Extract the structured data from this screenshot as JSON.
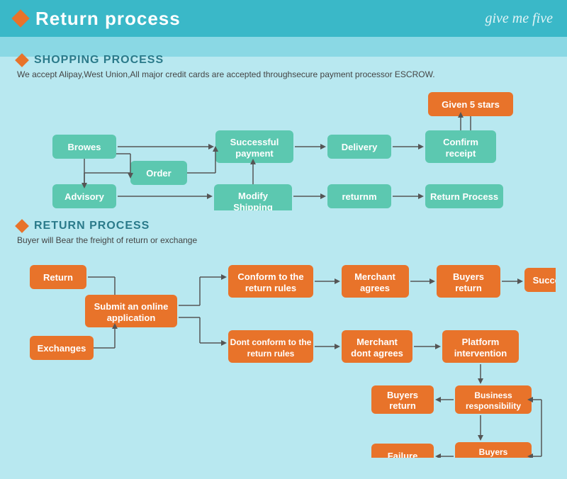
{
  "header": {
    "title": "Return process",
    "brand": "give me five"
  },
  "shopping": {
    "section_label": "SHOPPING PROCESS",
    "description": "We accept Alipay,West Union,All major credit cards are accepted throughsecure payment processor ESCROW.",
    "nodes": {
      "browes": "Browes",
      "order": "Order",
      "advisory": "Advisory",
      "modify_shipping": "Modify\nShipping",
      "successful_payment": "Successful\npayment",
      "delivery": "Delivery",
      "confirm_receipt": "Confirm\nreceipt",
      "given_5_stars": "Given 5 stars",
      "returnm": "returnm",
      "return_process": "Return Process"
    }
  },
  "return": {
    "section_label": "RETURN PROCESS",
    "description": "Buyer will Bear the freight of return or exchange",
    "nodes": {
      "return": "Return",
      "exchanges": "Exchanges",
      "submit_online": "Submit an online\napplication",
      "conform_return_rules": "Conform to the\nreturn rules",
      "dont_conform": "Dont conform to the\nreturn rules",
      "merchant_agrees": "Merchant\nagrees",
      "merchant_dont_agrees": "Merchant\ndont agrees",
      "buyers_return1": "Buyers\nreturn",
      "buyers_return2": "Buyers\nreturn",
      "platform_intervention": "Platform\nintervention",
      "success": "Success",
      "business_responsibility": "Business\nresponsibility",
      "buyers_responsibility": "Buyers\nresponsibility",
      "failure": "Failure"
    }
  }
}
